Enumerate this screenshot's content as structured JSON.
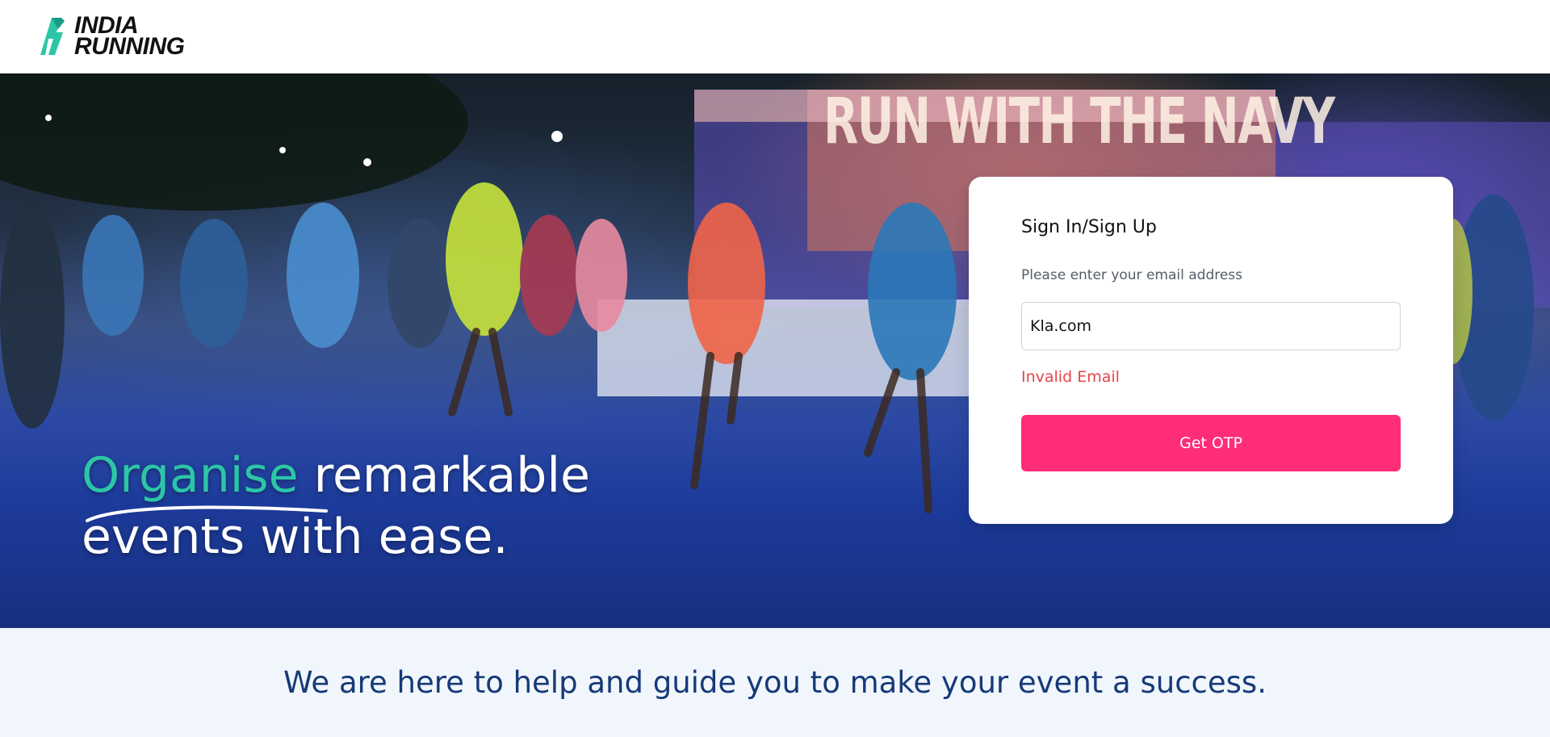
{
  "header": {
    "logo_line1": "INDIA",
    "logo_line2": "RUNNING",
    "logo_icon": "india-running-logo-mark"
  },
  "hero": {
    "banner_text": "RUN WITH THE NAVY",
    "heading_accent": "Organise",
    "heading_rest_line1": "remarkable",
    "heading_line2": "events with ease.",
    "colors": {
      "accent": "#2cc6a6"
    }
  },
  "signin_card": {
    "title": "Sign In/Sign Up",
    "prompt": "Please enter your email address",
    "email_value": "Kla.com",
    "error_message": "Invalid Email",
    "button_label": "Get OTP",
    "colors": {
      "button": "#ff2d78",
      "error": "#e8434a"
    }
  },
  "footer": {
    "tagline": "We are here to help and guide you to make your event a success."
  }
}
